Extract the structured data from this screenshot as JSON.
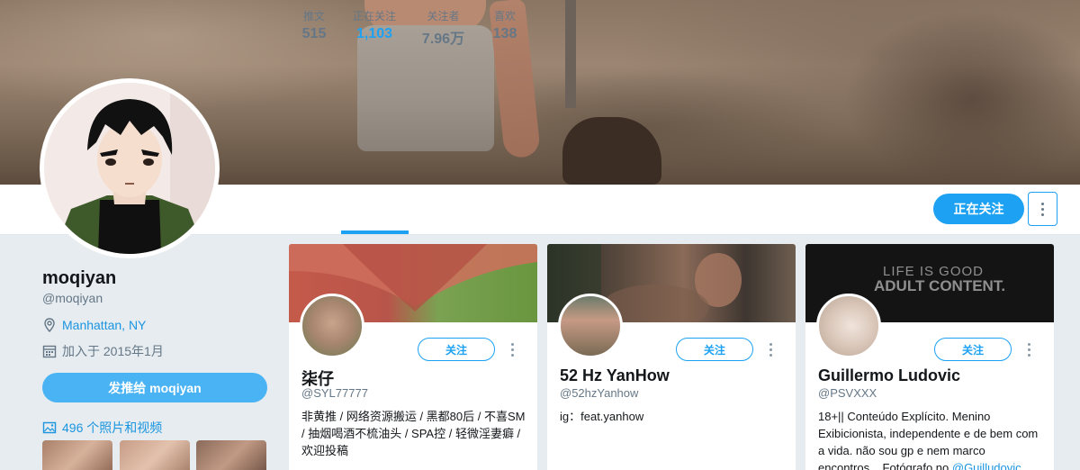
{
  "profile": {
    "name": "moqiyan",
    "handle": "@moqiyan",
    "location": "Manhattan, NY",
    "joined": "加入于 2015年1月",
    "tweet_to_label": "发推给 moqiyan",
    "photos_label": "496 个照片和视频"
  },
  "nav": {
    "stats": [
      {
        "label": "推文",
        "value": "515"
      },
      {
        "label": "正在关注",
        "value": "1,103"
      },
      {
        "label": "关注者",
        "value": "7.96万"
      },
      {
        "label": "喜欢",
        "value": "138"
      }
    ],
    "active_index": 1,
    "following_button": "正在关注"
  },
  "cards": [
    {
      "follow_label": "关注",
      "name": "柒仔",
      "handle": "@SYL77777",
      "bio": "非黄推 / 网络资源搬运 / 黑都80后 / 不喜SM / 抽烟喝酒不梳油头 / SPA控 / 轻微淫妻癖 / 欢迎投稿"
    },
    {
      "follow_label": "关注",
      "name": "52 Hz YanHow",
      "handle": "@52hzYanhow",
      "bio": "ig：feat.yanhow"
    },
    {
      "follow_label": "关注",
      "name": "Guillermo Ludovic",
      "handle": "@PSVXXX",
      "bio": "18+|| Conteúdo Explícito. Menino Exibicionista, independente e de bem com a vida. não sou gp e nem marco encontros... Fotógrafo no ",
      "bio_mention": "@Guilludovic",
      "cover_text_line1": "LIFE IS GOOD",
      "cover_text_line2": "ADULT CONTENT."
    }
  ],
  "colors": {
    "accent": "#1da1f2",
    "link": "#1b95e0",
    "background": "#e6ecf0",
    "muted": "#657786"
  }
}
